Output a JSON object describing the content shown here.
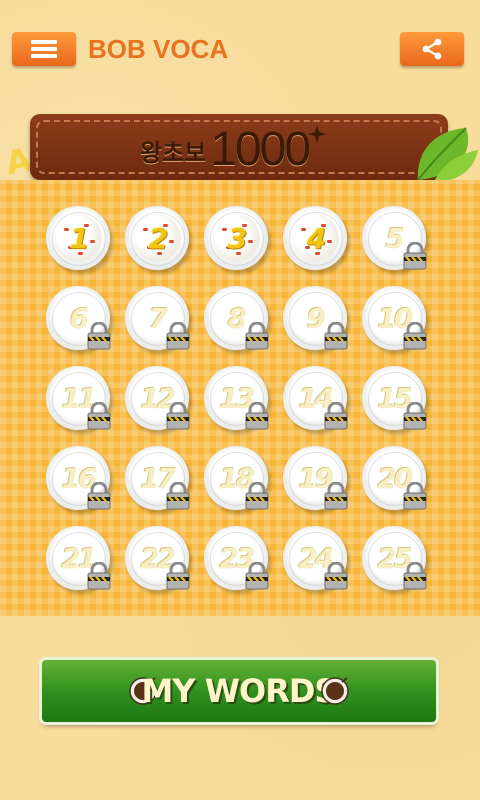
{
  "header": {
    "app_title": "BOB VOCA",
    "menu_icon": "hamburger-menu-icon",
    "share_icon": "share-icon",
    "accent_color": "#e9741f"
  },
  "banner": {
    "korean_text": "왕초보",
    "number_text": "1000"
  },
  "levels": [
    {
      "label": "1",
      "locked": false
    },
    {
      "label": "2",
      "locked": false
    },
    {
      "label": "3",
      "locked": false
    },
    {
      "label": "4",
      "locked": false
    },
    {
      "label": "5",
      "locked": true
    },
    {
      "label": "6",
      "locked": true
    },
    {
      "label": "7",
      "locked": true
    },
    {
      "label": "8",
      "locked": true
    },
    {
      "label": "9",
      "locked": true
    },
    {
      "label": "10",
      "locked": true
    },
    {
      "label": "11",
      "locked": true
    },
    {
      "label": "12",
      "locked": true
    },
    {
      "label": "13",
      "locked": true
    },
    {
      "label": "14",
      "locked": true
    },
    {
      "label": "15",
      "locked": true
    },
    {
      "label": "16",
      "locked": true
    },
    {
      "label": "17",
      "locked": true
    },
    {
      "label": "18",
      "locked": true
    },
    {
      "label": "19",
      "locked": true
    },
    {
      "label": "20",
      "locked": true
    },
    {
      "label": "21",
      "locked": true
    },
    {
      "label": "22",
      "locked": true
    },
    {
      "label": "23",
      "locked": true
    },
    {
      "label": "24",
      "locked": true
    },
    {
      "label": "25",
      "locked": true
    }
  ],
  "my_words": {
    "label": "MY WORDS",
    "icon": "coffee-cup-icon"
  }
}
